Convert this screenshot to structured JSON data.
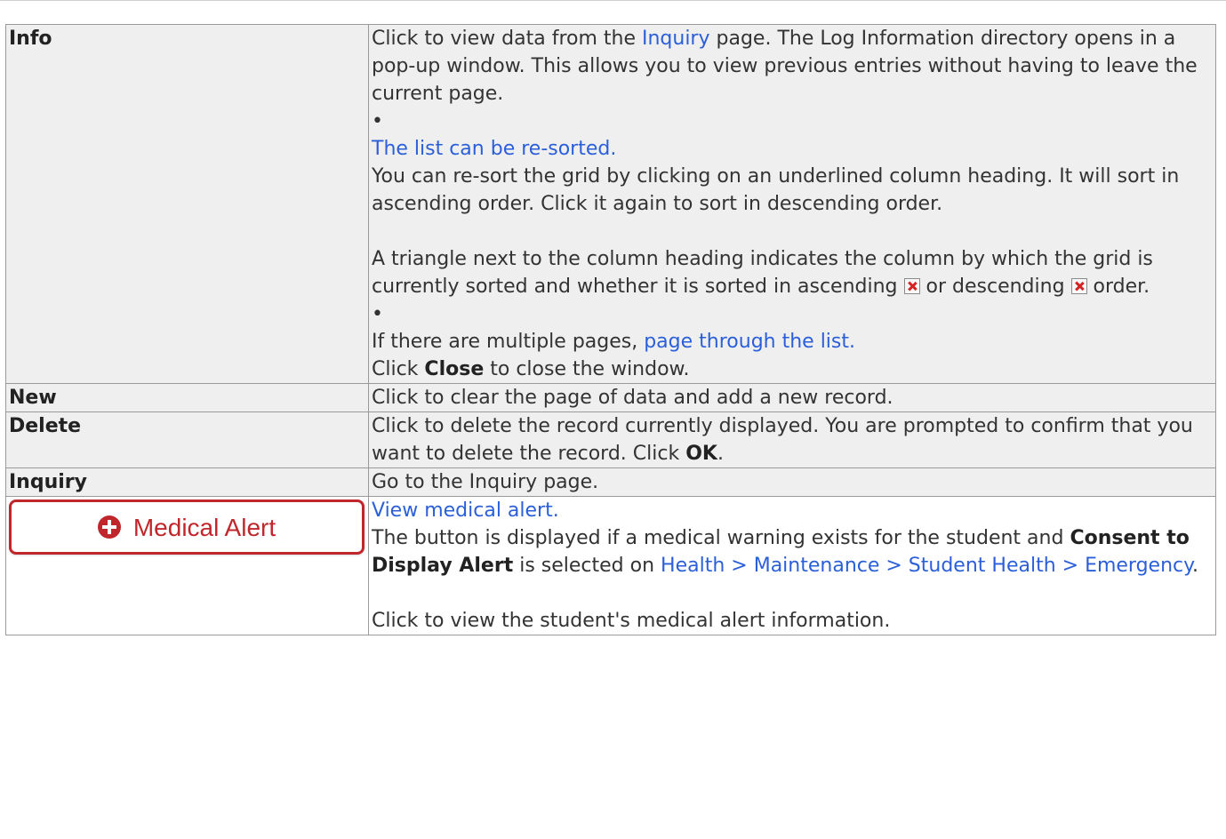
{
  "rows": [
    {
      "term": "Info",
      "p1_before": "Click to view data from the ",
      "p1_link": "Inquiry",
      "p1_after": " page. The Log Information directory opens in a pop-up window. This allows you to view previous entries without having to leave the current page.",
      "bullet": "•",
      "resort_link": "The list can be re-sorted.",
      "resort_text": "You can re-sort the grid by clicking on an underlined column heading. It will sort in ascending order. Click it again to sort in descending order.",
      "triangle_before": "A triangle next to the column heading indicates the column by which the grid is currently sorted and whether it is sorted in ascending ",
      "triangle_mid": " or descending ",
      "triangle_after": " order.",
      "pages_before": "If there are multiple pages, ",
      "pages_link": "page through the list.",
      "close_before": "Click ",
      "close_bold": "Close",
      "close_after": " to close the window."
    },
    {
      "term": "New",
      "text": "Click to clear the page of data and add a new record."
    },
    {
      "term": "Delete",
      "text_before": "Click to delete the record currently displayed. You are prompted to confirm that you want to delete the record. Click ",
      "text_bold": "OK",
      "text_after": "."
    },
    {
      "term": "Inquiry",
      "text": "Go to the Inquiry page."
    },
    {
      "button_label": "Medical Alert",
      "link": "View medical alert.",
      "p1": "The button is displayed if a medical warning exists for the student and ",
      "p1_bold": "Consent to Display Alert",
      "p1_mid": " is selected on ",
      "p1_link": "Health > Maintenance > Student Health > Emergency",
      "p1_after": ".",
      "p2": "Click to view the student's medical alert information."
    }
  ],
  "icons": {
    "ascending": "sort-ascending-icon",
    "descending": "sort-descending-icon",
    "medical": "plus-circle-icon"
  },
  "colors": {
    "link": "#2b5fd9",
    "alert": "#c0272d",
    "shaded_row": "#efefef"
  }
}
